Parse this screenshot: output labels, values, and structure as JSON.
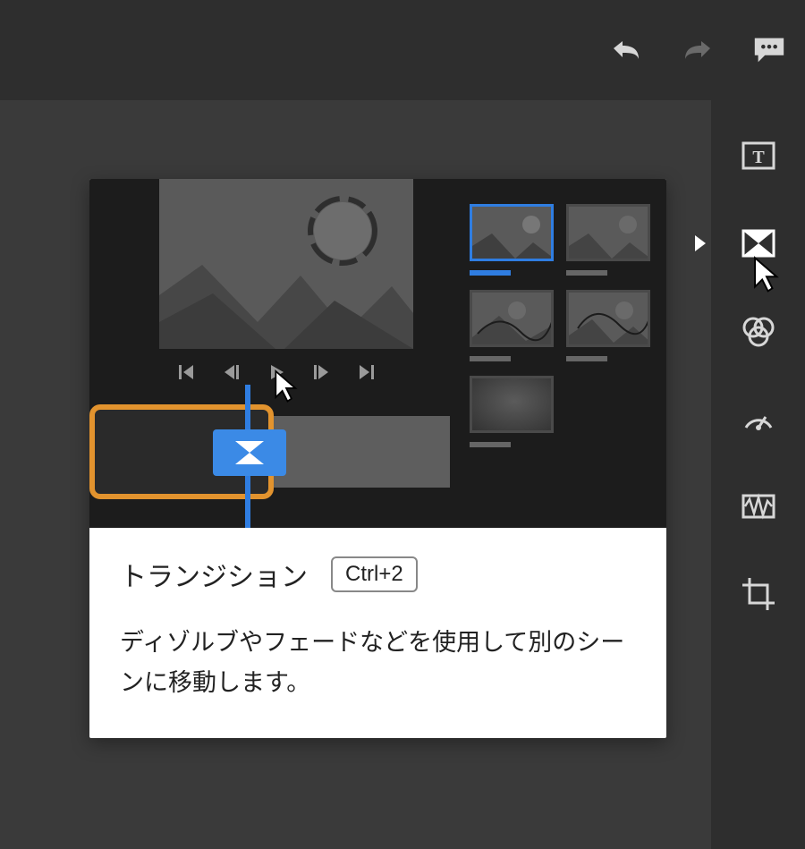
{
  "topbar": {
    "icons": {
      "undo": "undo-icon",
      "redo": "redo-icon",
      "comment": "comment-icon"
    }
  },
  "sidebar": {
    "items": [
      {
        "name": "titles-tool-icon"
      },
      {
        "name": "transitions-tool-icon"
      },
      {
        "name": "color-tool-icon"
      },
      {
        "name": "speed-tool-icon"
      },
      {
        "name": "audio-tool-icon"
      },
      {
        "name": "crop-tool-icon"
      }
    ],
    "active_index": 1
  },
  "tooltip": {
    "title": "トランジション",
    "shortcut": "Ctrl+2",
    "description": "ディゾルブやフェードなどを使用して別のシーンに移動します。",
    "transport": {
      "icons": [
        "go-start-icon",
        "step-back-icon",
        "play-icon",
        "step-forward-icon",
        "go-end-icon"
      ]
    },
    "thumbnails": [
      {
        "name": "preset-1",
        "selected": true
      },
      {
        "name": "preset-2",
        "selected": false
      },
      {
        "name": "preset-3",
        "selected": false
      },
      {
        "name": "preset-4",
        "selected": false
      },
      {
        "name": "preset-5",
        "selected": false
      }
    ]
  },
  "colors": {
    "accent": "#2f7de1",
    "clip_border": "#e2932e",
    "bg_dark": "#2e2e2e",
    "bg_canvas": "#3a3a3a"
  }
}
